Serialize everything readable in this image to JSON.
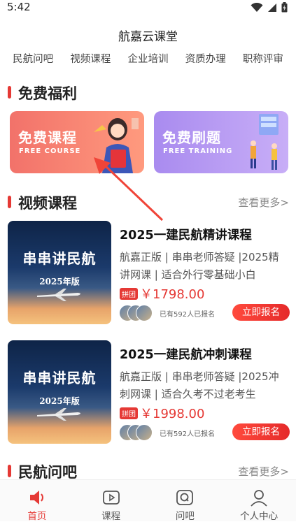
{
  "status": {
    "time": "5:42"
  },
  "app": {
    "title": "航嘉云课堂"
  },
  "top_nav": [
    "民航问吧",
    "视频课程",
    "企业培训",
    "资质办理",
    "职称评审"
  ],
  "sections": {
    "welfare": {
      "title": "免费福利"
    },
    "video": {
      "title": "视频课程",
      "more": "查看更多>"
    },
    "qa": {
      "title": "民航问吧",
      "more": "查看更多>"
    }
  },
  "promos": [
    {
      "title": "免费课程",
      "subtitle": "FREE COURSE"
    },
    {
      "title": "免费刷题",
      "subtitle": "FREE TRAINING"
    }
  ],
  "courses": [
    {
      "cover_title": "串串讲民航",
      "cover_year": "2025年版",
      "title": "2025一建民航精讲课程",
      "desc": "航嘉正版 | 串串老师答疑 |2025精讲网课 | 适合外行零基础小白",
      "tag": "拼团",
      "price": "￥1798.00",
      "enrolled": "已有592人已报名",
      "button": "立即报名"
    },
    {
      "cover_title": "串串讲民航",
      "cover_year": "2025年版",
      "title": "2025一建民航冲刺课程",
      "desc": "航嘉正版 | 串串老师答疑 |2025冲刺网课 | 适合久考不过老考生",
      "tag": "拼团",
      "price": "￥1998.00",
      "enrolled": "已有592人已报名",
      "button": "立即报名"
    }
  ],
  "tabbar": [
    {
      "label": "首页",
      "icon": "speaker-icon",
      "active": true
    },
    {
      "label": "课程",
      "icon": "play-icon",
      "active": false
    },
    {
      "label": "问吧",
      "icon": "question-icon",
      "active": false
    },
    {
      "label": "个人中心",
      "icon": "user-icon",
      "active": false
    }
  ],
  "colors": {
    "accent": "#e53935",
    "promo_free": "#f2726a",
    "promo_train": "#a98bef"
  }
}
